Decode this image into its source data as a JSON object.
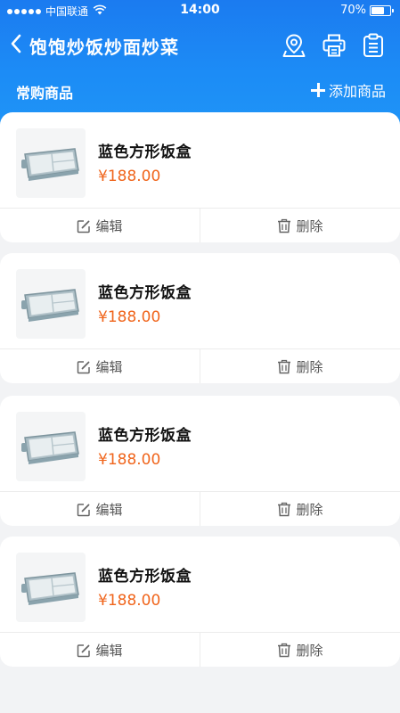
{
  "status_bar": {
    "carrier": "中国联通",
    "time": "14:00",
    "battery": "70%",
    "battery_level": 0.7
  },
  "nav": {
    "title": "饱饱炒饭炒面炒菜"
  },
  "section": {
    "title": "常购商品",
    "add_label": "添加商品"
  },
  "products": [
    {
      "name": "蓝色方形饭盒",
      "price": "¥188.00",
      "edit_label": "编辑",
      "delete_label": "删除"
    },
    {
      "name": "蓝色方形饭盒",
      "price": "¥188.00",
      "edit_label": "编辑",
      "delete_label": "删除"
    },
    {
      "name": "蓝色方形饭盒",
      "price": "¥188.00",
      "edit_label": "编辑",
      "delete_label": "删除"
    },
    {
      "name": "蓝色方形饭盒",
      "price": "¥188.00",
      "edit_label": "编辑",
      "delete_label": "删除"
    }
  ],
  "colors": {
    "header_blue": "#1c8cf6",
    "price_orange": "#f0651c"
  },
  "icons": [
    "back-icon",
    "location-icon",
    "printer-icon",
    "clipboard-icon",
    "plus-icon",
    "edit-icon",
    "trash-icon",
    "signal-dots-icon",
    "wifi-icon",
    "battery-icon"
  ]
}
